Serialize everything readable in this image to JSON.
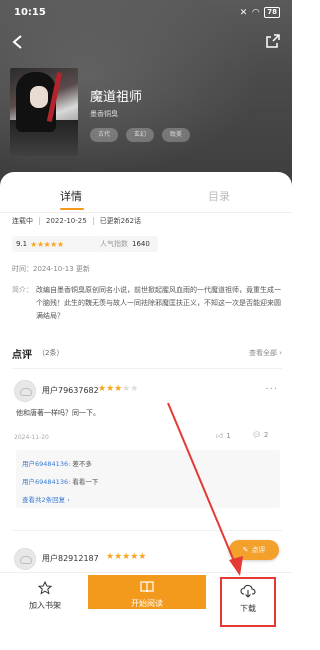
{
  "status_bar": {
    "time": "10:15",
    "battery": "78"
  },
  "book": {
    "title": "魔道祖师",
    "author": "墨香铜臭",
    "tags": [
      "古代",
      "玄幻",
      "耽美"
    ]
  },
  "tabs": {
    "detail": "详情",
    "toc": "目录"
  },
  "meta": {
    "status": "连载中",
    "date": "2022-10-25",
    "chapters": "已更新262话"
  },
  "rating": {
    "score": "9.1",
    "stars": "★★★★★",
    "popularity_label": "人气指数",
    "popularity_value": "1640"
  },
  "update_time": "时间：2024-10-13 更新",
  "intro": {
    "label": "简介：",
    "text": "改编自墨香铜臭原创同名小说，前世掀起腥风血雨的一代魔道祖师，竟重生成一个脑残！此生的魏无羡与故人一同祛除邪魔匡扶正义，不知这一次是否能迎来圆满结局？"
  },
  "reviews_section": {
    "title": "点评",
    "count": "（2条）",
    "view_all": "查看全部"
  },
  "reviews": [
    {
      "user": "用户79637682",
      "stars_on": "★★★",
      "stars_off": "★★",
      "content": "他和唐著一样吗？同一下。",
      "date": "2024-11-20",
      "likes": "1",
      "comments": "2",
      "replies": [
        {
          "user": "用户69484136:",
          "text": "差不多"
        },
        {
          "user": "用户69484136:",
          "text": "看看一下"
        }
      ],
      "more_replies": "查看共2条回复"
    },
    {
      "user": "用户82912187",
      "stars_on": "★★★★★",
      "stars_off": ""
    }
  ],
  "review_fab": "点评",
  "bottom_bar": {
    "shelf": "加入书架",
    "read": "开始阅读",
    "download": "下载"
  },
  "colors": {
    "accent": "#f39a1c",
    "highlight": "#e53935",
    "star": "#f5a623",
    "link": "#3a7bd5"
  }
}
